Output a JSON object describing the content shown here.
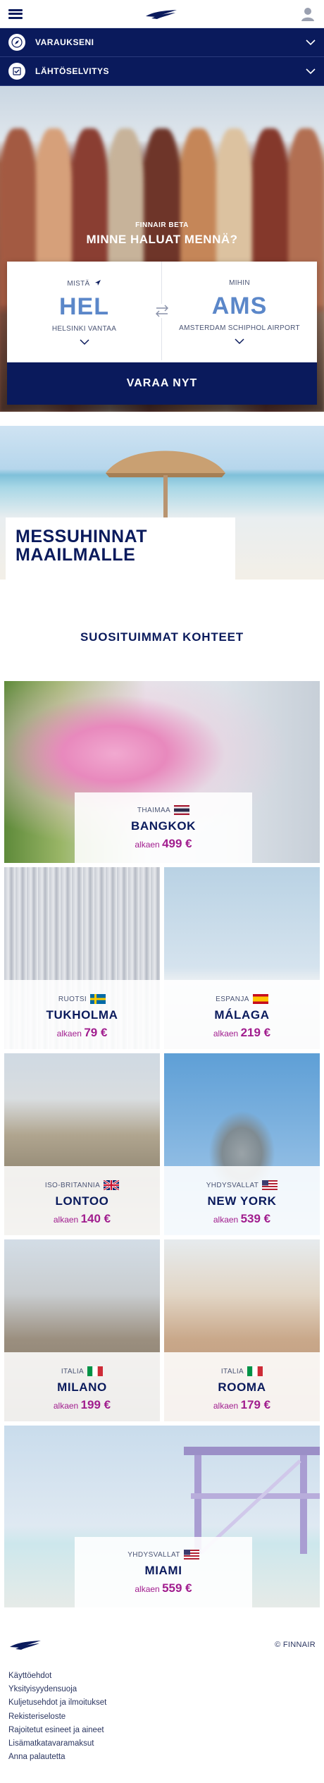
{
  "header": {
    "menu_icon": "hamburger-menu-icon",
    "logo_icon": "finnair-logo",
    "user_icon": "user-icon"
  },
  "accordions": [
    {
      "label": "VARAUKSENI",
      "icon": "compass-icon"
    },
    {
      "label": "LÄHTÖSELVITYS",
      "icon": "checkin-icon"
    }
  ],
  "hero": {
    "kicker": "FINNAIR BETA",
    "title": "MINNE HALUAT MENNÄ?",
    "from": {
      "label": "MISTÄ",
      "code": "HEL",
      "airport": "HELSINKI VANTAA"
    },
    "to": {
      "label": "MIHIN",
      "code": "AMS",
      "airport": "AMSTERDAM SCHIPHOL AIRPORT"
    },
    "book_label": "VARAA NYT"
  },
  "promo": {
    "title_line1": "MESSUHINNAT",
    "title_line2": "MAAILMALLE"
  },
  "section_title": "SUOSITUIMMAT KOHTEET",
  "destinations": [
    {
      "country": "THAIMAA",
      "city": "BANGKOK",
      "from": "alkaen",
      "price": "499 €"
    },
    {
      "country": "RUOTSI",
      "city": "TUKHOLMA",
      "from": "alkaen",
      "price": "79 €"
    },
    {
      "country": "ESPANJA",
      "city": "MÁLAGA",
      "from": "alkaen",
      "price": "219 €"
    },
    {
      "country": "ISO-BRITANNIA",
      "city": "LONTOO",
      "from": "alkaen",
      "price": "140 €"
    },
    {
      "country": "YHDYSVALLAT",
      "city": "NEW YORK",
      "from": "alkaen",
      "price": "539 €"
    },
    {
      "country": "ITALIA",
      "city": "MILANO",
      "from": "alkaen",
      "price": "199 €"
    },
    {
      "country": "ITALIA",
      "city": "ROOMA",
      "from": "alkaen",
      "price": "179 €"
    },
    {
      "country": "YHDYSVALLAT",
      "city": "MIAMI",
      "from": "alkaen",
      "price": "559 €"
    }
  ],
  "footer": {
    "copyright": "© FINNAIR",
    "links": [
      "Käyttöehdot",
      "Yksityisyydensuoja",
      "Kuljetusehdot ja ilmoitukset",
      "Rekisteriseloste",
      "Rajoitetut esineet ja aineet",
      "Lisämatkatavaramaksut",
      "Anna palautetta"
    ]
  },
  "colors": {
    "brand": "#0a1a5c",
    "accent_code": "#5b87c9",
    "price": "#a11d8e"
  }
}
